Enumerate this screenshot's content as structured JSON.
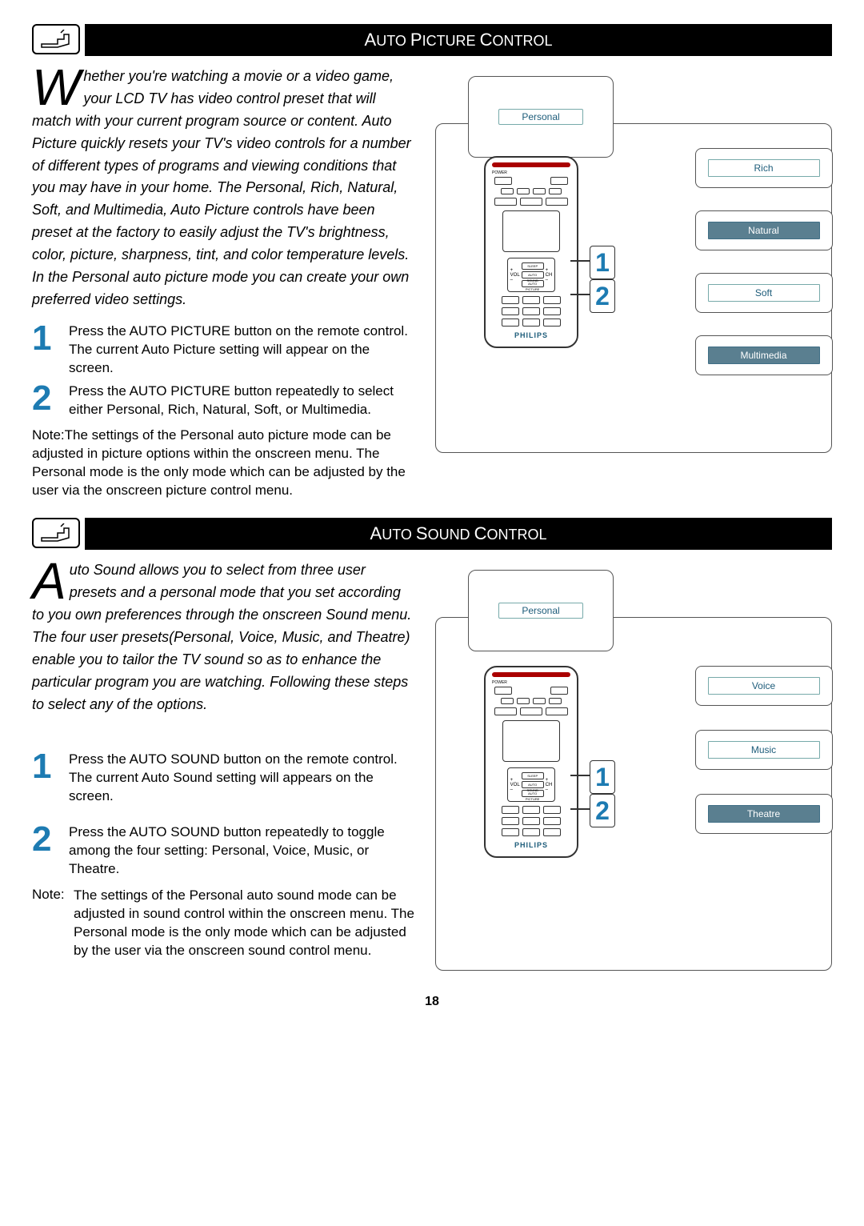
{
  "section1": {
    "title_prefix": "A",
    "title_rest_upper": "UTO ",
    "title_mid_prefix": "P",
    "title_mid_rest": "ICTURE ",
    "title_suffix_prefix": "C",
    "title_suffix_rest": "ONTROL",
    "dropcap": "W",
    "intro": "hether you're watching a movie or a video game, your LCD TV has video control preset that will match with your current program source or content. Auto Picture quickly resets your TV's video controls for a number of different types of programs and viewing conditions that you may have in your home. The Personal, Rich, Natural, Soft, and Multimedia, Auto Picture controls have been preset at the factory to easily adjust the TV's brightness, color, picture, sharpness, tint, and color temperature levels. In the Personal auto picture mode you can create your own preferred video settings.",
    "steps": [
      "Press the AUTO PICTURE button on the remote control. The current Auto Picture setting will appear on the screen.",
      "Press the AUTO PICTURE button repeatedly to select either Personal, Rich, Natural, Soft, or Multimedia."
    ],
    "note": "Note:The settings of the Personal auto picture mode can be adjusted in picture options within the onscreen menu. The Personal mode is the only mode which can be adjusted by the user via the onscreen picture control menu.",
    "osd": "Personal",
    "modes": [
      "Rich",
      "Natural",
      "Soft",
      "Multimedia"
    ],
    "remote_brand": "PHILIPS",
    "callouts": [
      "1",
      "2"
    ]
  },
  "section2": {
    "title_prefix": "A",
    "title_rest_upper": "UTO ",
    "title_mid_prefix": "S",
    "title_mid_rest": "OUND ",
    "title_suffix_prefix": "C",
    "title_suffix_rest": "ONTROL",
    "dropcap": "A",
    "intro": "uto Sound allows you to select from three user presets and a personal mode that you set according to you own preferences through the onscreen Sound menu. The four user presets(Personal, Voice, Music, and Theatre) enable you to tailor the TV sound so as to enhance the particular program you are watching. Following these steps to select any of the options.",
    "steps": [
      "Press the AUTO SOUND button on the remote control. The current Auto Sound setting will appears on the screen.",
      "Press the AUTO SOUND button repeatedly to toggle among the four setting: Personal, Voice, Music, or Theatre."
    ],
    "note_label": "Note:",
    "note": "The settings of the Personal auto sound mode can be adjusted in sound control within the onscreen menu. The Personal  mode is the only mode which can be adjusted by the user via the onscreen sound control menu.",
    "osd": "Personal",
    "modes": [
      "Voice",
      "Music",
      "Theatre"
    ],
    "remote_brand": "PHILIPS",
    "callouts": [
      "1",
      "2"
    ]
  },
  "page_number": "18"
}
